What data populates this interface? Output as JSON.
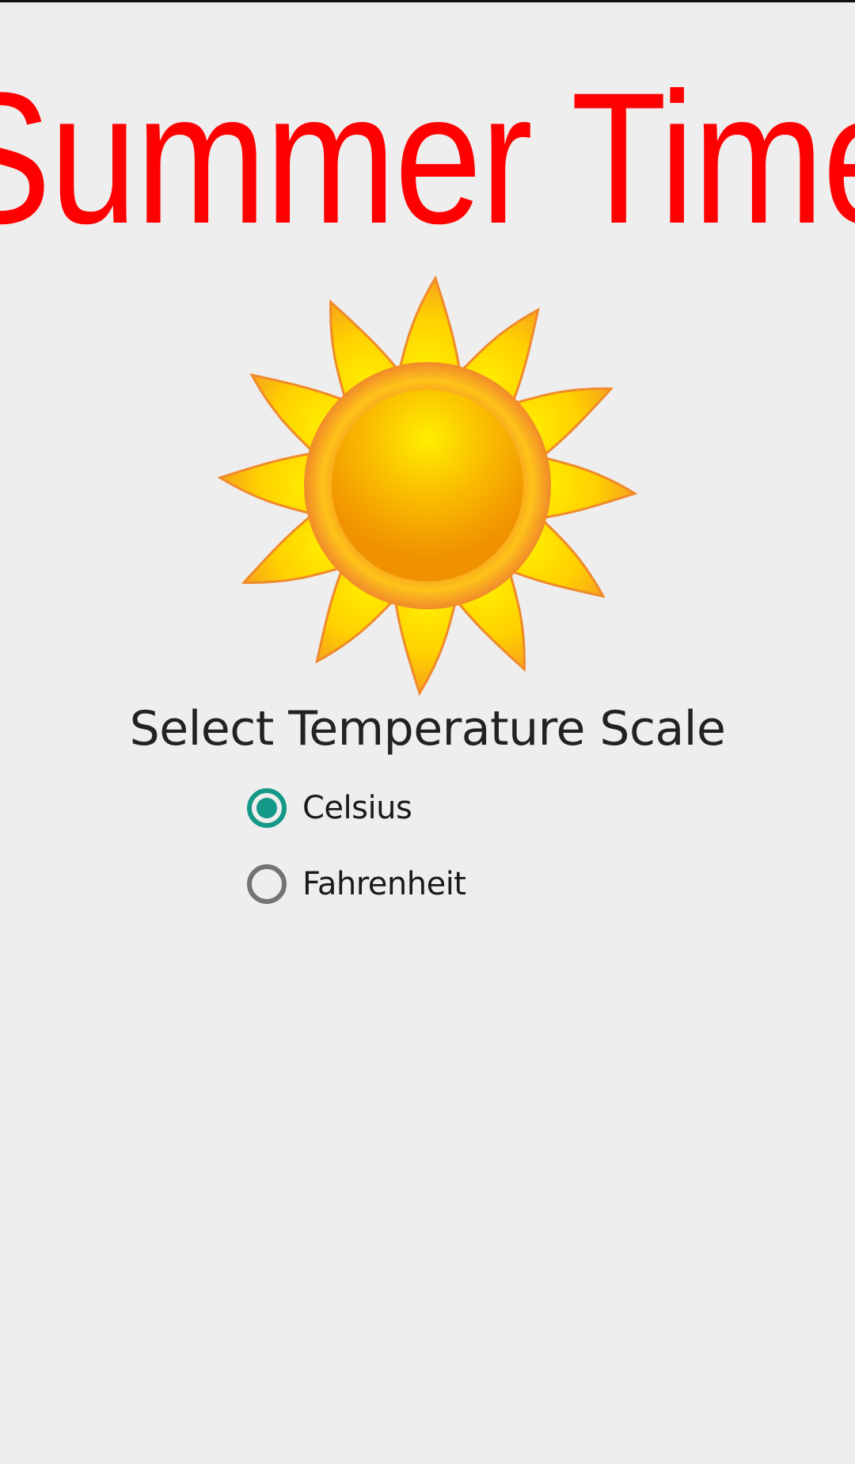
{
  "app": {
    "title": "Summer Time"
  },
  "image": {
    "icon": "sun-icon",
    "alt": "sun"
  },
  "temperature_scale": {
    "heading": "Select Temperature Scale",
    "options": [
      {
        "label": "Celsius",
        "checked": true
      },
      {
        "label": "Fahrenheit",
        "checked": false
      }
    ],
    "selected": "Celsius"
  },
  "colors": {
    "title_red": "#ff0000",
    "accent_teal": "#149887",
    "radio_off_gray": "#737373",
    "background": "#eeeeee"
  }
}
